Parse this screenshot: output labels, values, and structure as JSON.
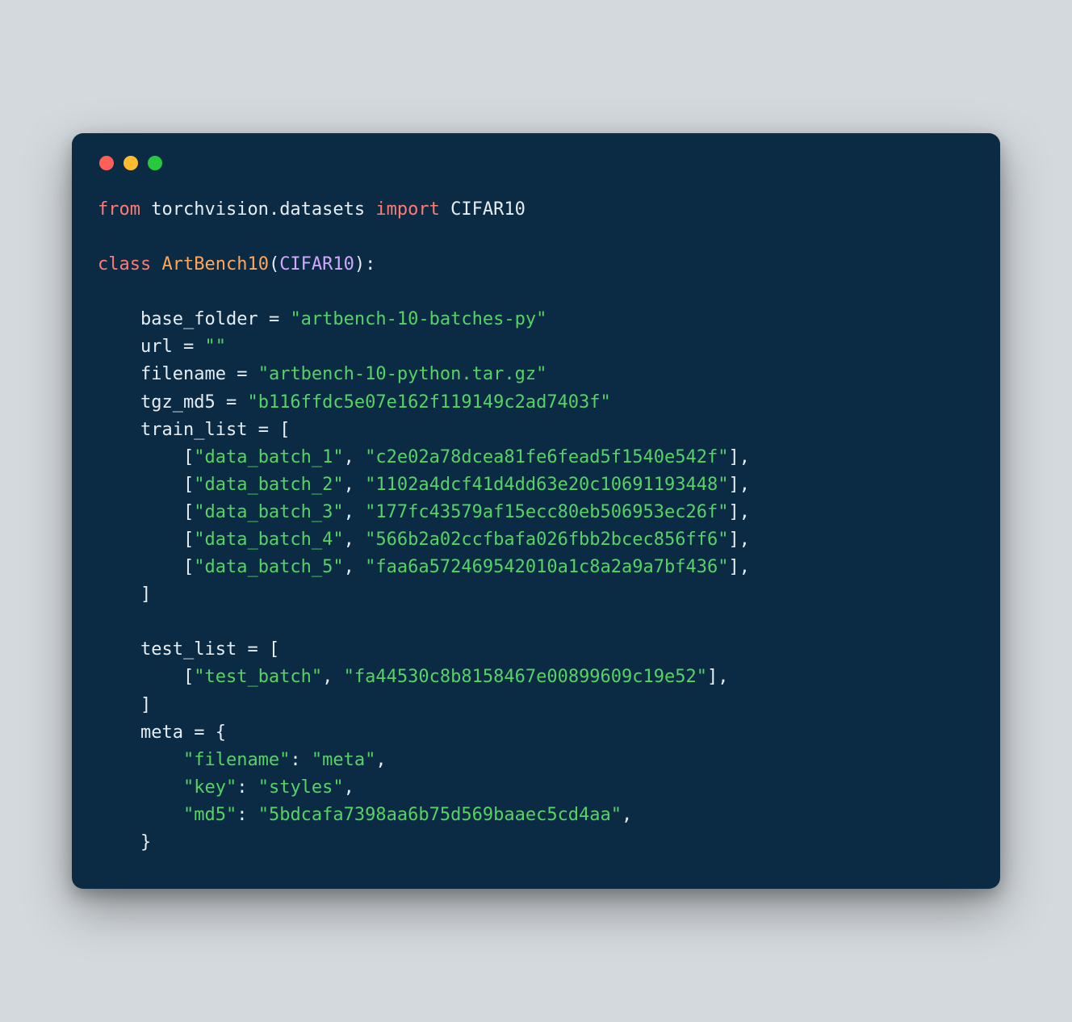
{
  "code": {
    "line1": {
      "kw_from": "from",
      "mod1": "torchvision",
      "dot": ".",
      "mod2": "datasets",
      "kw_import": "import",
      "cls": "CIFAR10"
    },
    "line2": {
      "kw_class": "class",
      "name": "ArtBench10",
      "base": "CIFAR10"
    },
    "base_folder": {
      "label": "base_folder",
      "value": "\"artbench-10-batches-py\""
    },
    "url": {
      "label": "url",
      "value": "\"\""
    },
    "filename": {
      "label": "filename",
      "value": "\"artbench-10-python.tar.gz\""
    },
    "tgz_md5": {
      "label": "tgz_md5",
      "value": "\"b116ffdc5e07e162f119149c2ad7403f\""
    },
    "train_list": {
      "label": "train_list"
    },
    "train": [
      {
        "name": "\"data_batch_1\"",
        "md5": "\"c2e02a78dcea81fe6fead5f1540e542f\""
      },
      {
        "name": "\"data_batch_2\"",
        "md5": "\"1102a4dcf41d4dd63e20c10691193448\""
      },
      {
        "name": "\"data_batch_3\"",
        "md5": "\"177fc43579af15ecc80eb506953ec26f\""
      },
      {
        "name": "\"data_batch_4\"",
        "md5": "\"566b2a02ccfbafa026fbb2bcec856ff6\""
      },
      {
        "name": "\"data_batch_5\"",
        "md5": "\"faa6a572469542010a1c8a2a9a7bf436\""
      }
    ],
    "test_list": {
      "label": "test_list"
    },
    "test": [
      {
        "name": "\"test_batch\"",
        "md5": "\"fa44530c8b8158467e00899609c19e52\""
      }
    ],
    "meta": {
      "label": "meta",
      "filename_key": "\"filename\"",
      "filename_val": "\"meta\"",
      "key_key": "\"key\"",
      "key_val": "\"styles\"",
      "md5_key": "\"md5\"",
      "md5_val": "\"5bdcafa7398aa6b75d569baaec5cd4aa\""
    }
  },
  "colors": {
    "background": "#0b2b45",
    "page": "#d4d9dd",
    "keyword": "#ff7b72",
    "string": "#56d364",
    "class": "#ffa657",
    "function": "#d2a8ff",
    "text": "#e6edf3"
  }
}
